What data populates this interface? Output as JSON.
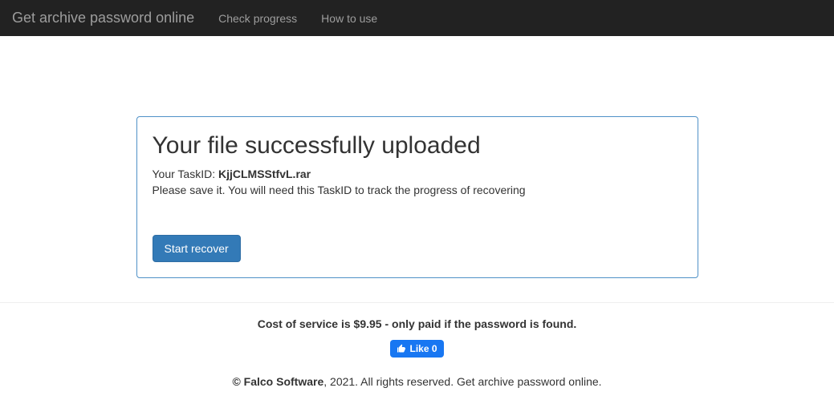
{
  "navbar": {
    "brand": "Get archive password online",
    "links": {
      "check_progress": "Check progress",
      "how_to_use": "How to use"
    }
  },
  "panel": {
    "heading": "Your file successfully uploaded",
    "task_label": "Your TaskID: ",
    "task_id": "KjjCLMSStfvL.rar",
    "save_hint": "Please save it. You will need this TaskID to track the progress of recovering",
    "start_button": "Start recover"
  },
  "footer": {
    "cost_line": "Cost of service is $9.95 - only paid if the password is found.",
    "fb_like": "Like 0",
    "copyright_company": "© Falco Software",
    "copyright_rest": ", 2021. All rights reserved. Get archive password online."
  }
}
